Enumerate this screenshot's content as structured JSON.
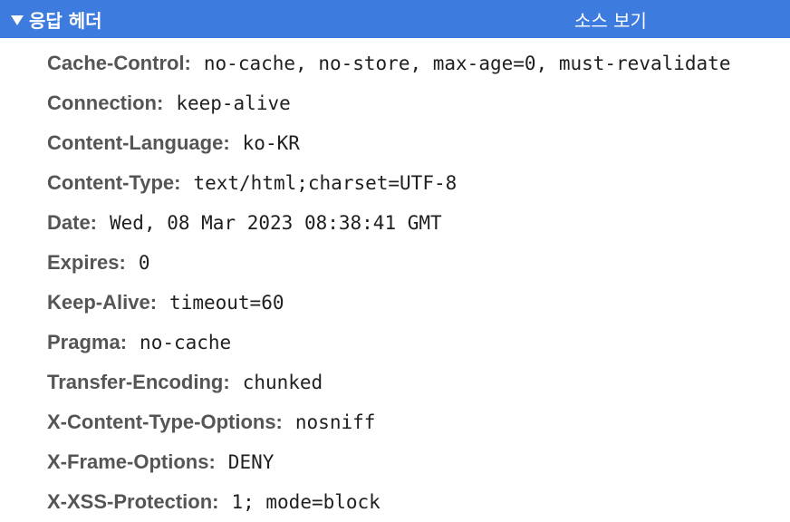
{
  "section": {
    "title": "응답 헤더",
    "view_source_label": "소스 보기",
    "toggle_icon": "disclosure-triangle-down-icon"
  },
  "headers": [
    {
      "name": "Cache-Control:",
      "value": "no-cache, no-store, max-age=0, must-revalidate"
    },
    {
      "name": "Connection:",
      "value": "keep-alive"
    },
    {
      "name": "Content-Language:",
      "value": "ko-KR"
    },
    {
      "name": "Content-Type:",
      "value": "text/html;charset=UTF-8"
    },
    {
      "name": "Date:",
      "value": "Wed, 08 Mar 2023 08:38:41 GMT"
    },
    {
      "name": "Expires:",
      "value": "0"
    },
    {
      "name": "Keep-Alive:",
      "value": "timeout=60"
    },
    {
      "name": "Pragma:",
      "value": "no-cache"
    },
    {
      "name": "Transfer-Encoding:",
      "value": "chunked"
    },
    {
      "name": "X-Content-Type-Options:",
      "value": "nosniff"
    },
    {
      "name": "X-Frame-Options:",
      "value": "DENY"
    },
    {
      "name": "X-XSS-Protection:",
      "value": "1; mode=block"
    }
  ],
  "colors": {
    "header_bar": "#3d7cde",
    "header_text": "#ffffff",
    "name_text": "#555555",
    "value_text": "#1f1f1f"
  }
}
